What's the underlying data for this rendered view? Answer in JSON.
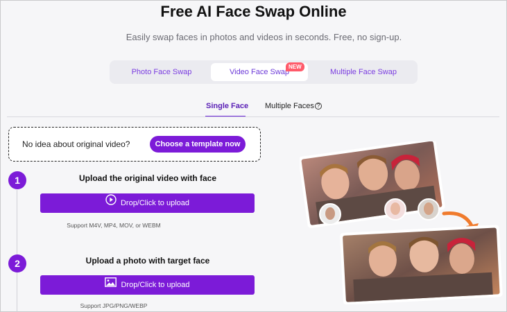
{
  "header": {
    "title": "Free AI Face Swap Online",
    "subtitle": "Easily swap faces in photos and videos in seconds. Free, no sign-up."
  },
  "mode_tabs": {
    "items": [
      "Photo Face Swap",
      "Video Face Swap",
      "Multiple Face Swap"
    ],
    "selected": "Video Face Swap",
    "badge": "NEW"
  },
  "face_tabs": {
    "items": [
      "Single Face",
      "Multiple Faces"
    ],
    "selected": "Single Face"
  },
  "template_prompt": {
    "text": "No idea about original video?",
    "button": "Choose a template now"
  },
  "steps": [
    {
      "number": "1",
      "title": "Upload the original video with face",
      "button": "Drop/Click to upload",
      "icon": "play-circle-icon",
      "support": "Support M4V, MP4, MOV, or WEBM"
    },
    {
      "number": "2",
      "title": "Upload a photo with target face",
      "button": "Drop/Click to upload",
      "icon": "image-icon",
      "support": "Support JPG/PNG/WEBP"
    }
  ],
  "colors": {
    "accent": "#7c1bd8",
    "badge": "#ff5a6a",
    "arrow": "#f07b2d"
  }
}
